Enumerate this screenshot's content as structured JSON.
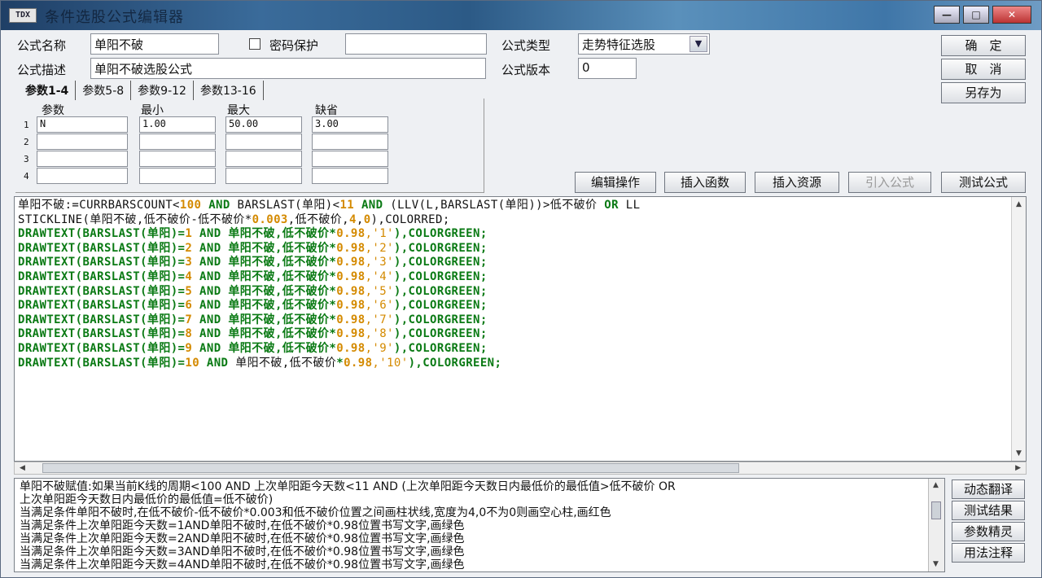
{
  "window": {
    "icon_text": "TDX",
    "title": "条件选股公式编辑器"
  },
  "form": {
    "name_label": "公式名称",
    "name_value": "单阳不破",
    "password_label": "密码保护",
    "password_value": "",
    "desc_label": "公式描述",
    "desc_value": "单阳不破选股公式",
    "type_label": "公式类型",
    "type_value": "走势特征选股",
    "version_label": "公式版本",
    "version_value": "0"
  },
  "buttons": {
    "ok": "确　定",
    "cancel": "取　消",
    "save_as": "另存为",
    "edit_op": "编辑操作",
    "insert_func": "插入函数",
    "insert_resource": "插入资源",
    "import_formula": "引入公式",
    "test_formula": "测试公式",
    "dynamic_translate": "动态翻译",
    "test_result": "测试结果",
    "param_wizard": "参数精灵",
    "usage_notes": "用法注释"
  },
  "tabs": [
    "参数1-4",
    "参数5-8",
    "参数9-12",
    "参数13-16"
  ],
  "params": {
    "headers": [
      "参数",
      "最小",
      "最大",
      "缺省"
    ],
    "rows": [
      {
        "num": "1",
        "name": "N",
        "min": "1.00",
        "max": "50.00",
        "default": "3.00"
      },
      {
        "num": "2",
        "name": "",
        "min": "",
        "max": "",
        "default": ""
      },
      {
        "num": "3",
        "name": "",
        "min": "",
        "max": "",
        "default": ""
      },
      {
        "num": "4",
        "name": "",
        "min": "",
        "max": "",
        "default": ""
      }
    ]
  },
  "code_lines": [
    [
      {
        "t": "单阳不破:=CURRBARSCOUNT<",
        "c": "black"
      },
      {
        "t": "100",
        "c": "num"
      },
      {
        "t": " AND ",
        "c": "kw"
      },
      {
        "t": "BARSLAST(单阳)<",
        "c": "black"
      },
      {
        "t": "11",
        "c": "num"
      },
      {
        "t": " AND ",
        "c": "kw"
      },
      {
        "t": "(LLV(L,BARSLAST(单阳))>低不破价 ",
        "c": "black"
      },
      {
        "t": "OR",
        "c": "kw"
      },
      {
        "t": " LL",
        "c": "black"
      }
    ],
    [
      {
        "t": "STICKLINE(单阳不破,低不破价-低不破价*",
        "c": "black"
      },
      {
        "t": "0.003",
        "c": "num"
      },
      {
        "t": ",低不破价,",
        "c": "black"
      },
      {
        "t": "4",
        "c": "num"
      },
      {
        "t": ",",
        "c": "black"
      },
      {
        "t": "0",
        "c": "num"
      },
      {
        "t": "),COLORRED;",
        "c": "black"
      }
    ],
    [
      {
        "t": "DRAWTEXT(BARSLAST(单阳)=",
        "c": "kw"
      },
      {
        "t": "1",
        "c": "num"
      },
      {
        "t": " AND 单阳不破,低不破价*",
        "c": "kw"
      },
      {
        "t": "0.98",
        "c": "num"
      },
      {
        "t": ",'1'",
        "c": "str"
      },
      {
        "t": "),COLORGREEN;",
        "c": "kw"
      }
    ],
    [
      {
        "t": "DRAWTEXT(BARSLAST(单阳)=",
        "c": "kw"
      },
      {
        "t": "2",
        "c": "num"
      },
      {
        "t": " AND 单阳不破,低不破价*",
        "c": "kw"
      },
      {
        "t": "0.98",
        "c": "num"
      },
      {
        "t": ",'2'",
        "c": "str"
      },
      {
        "t": "),COLORGREEN;",
        "c": "kw"
      }
    ],
    [
      {
        "t": "DRAWTEXT(BARSLAST(单阳)=",
        "c": "kw"
      },
      {
        "t": "3",
        "c": "num"
      },
      {
        "t": " AND 单阳不破,低不破价*",
        "c": "kw"
      },
      {
        "t": "0.98",
        "c": "num"
      },
      {
        "t": ",'3'",
        "c": "str"
      },
      {
        "t": "),COLORGREEN;",
        "c": "kw"
      }
    ],
    [
      {
        "t": "DRAWTEXT(BARSLAST(单阳)=",
        "c": "kw"
      },
      {
        "t": "4",
        "c": "num"
      },
      {
        "t": " AND 单阳不破,低不破价*",
        "c": "kw"
      },
      {
        "t": "0.98",
        "c": "num"
      },
      {
        "t": ",'4'",
        "c": "str"
      },
      {
        "t": "),COLORGREEN;",
        "c": "kw"
      }
    ],
    [
      {
        "t": "DRAWTEXT(BARSLAST(单阳)=",
        "c": "kw"
      },
      {
        "t": "5",
        "c": "num"
      },
      {
        "t": " AND 单阳不破,低不破价*",
        "c": "kw"
      },
      {
        "t": "0.98",
        "c": "num"
      },
      {
        "t": ",'5'",
        "c": "str"
      },
      {
        "t": "),COLORGREEN;",
        "c": "kw"
      }
    ],
    [
      {
        "t": "DRAWTEXT(BARSLAST(单阳)=",
        "c": "kw"
      },
      {
        "t": "6",
        "c": "num"
      },
      {
        "t": " AND 单阳不破,低不破价*",
        "c": "kw"
      },
      {
        "t": "0.98",
        "c": "num"
      },
      {
        "t": ",'6'",
        "c": "str"
      },
      {
        "t": "),COLORGREEN;",
        "c": "kw"
      }
    ],
    [
      {
        "t": "DRAWTEXT(BARSLAST(单阳)=",
        "c": "kw"
      },
      {
        "t": "7",
        "c": "num"
      },
      {
        "t": " AND 单阳不破,低不破价*",
        "c": "kw"
      },
      {
        "t": "0.98",
        "c": "num"
      },
      {
        "t": ",'7'",
        "c": "str"
      },
      {
        "t": "),COLORGREEN;",
        "c": "kw"
      }
    ],
    [
      {
        "t": "DRAWTEXT(BARSLAST(单阳)=",
        "c": "kw"
      },
      {
        "t": "8",
        "c": "num"
      },
      {
        "t": " AND 单阳不破,低不破价*",
        "c": "kw"
      },
      {
        "t": "0.98",
        "c": "num"
      },
      {
        "t": ",'8'",
        "c": "str"
      },
      {
        "t": "),COLORGREEN;",
        "c": "kw"
      }
    ],
    [
      {
        "t": "DRAWTEXT(BARSLAST(单阳)=",
        "c": "kw"
      },
      {
        "t": "9",
        "c": "num"
      },
      {
        "t": " AND 单阳不破,低不破价*",
        "c": "kw"
      },
      {
        "t": "0.98",
        "c": "num"
      },
      {
        "t": ",'9'",
        "c": "str"
      },
      {
        "t": "),COLORGREEN;",
        "c": "kw"
      }
    ],
    [
      {
        "t": "DRAWTEXT(BARSLAST(单阳)=",
        "c": "kw"
      },
      {
        "t": "10",
        "c": "num"
      },
      {
        "t": " AND ",
        "c": "kw"
      },
      {
        "t": "单阳不破,低不破价",
        "c": "black"
      },
      {
        "t": "*",
        "c": "kw"
      },
      {
        "t": "0.98",
        "c": "num"
      },
      {
        "t": ",'10'",
        "c": "str"
      },
      {
        "t": "),COLORGREEN;",
        "c": "kw"
      }
    ]
  ],
  "description_lines": [
    "单阳不破赋值:如果当前K线的周期<100 AND 上次单阳距今天数<11 AND (上次单阳距今天数日内最低价的最低值>低不破价 OR",
    "上次单阳距今天数日内最低价的最低值=低不破价)",
    "当满足条件单阳不破时,在低不破价-低不破价*0.003和低不破价位置之间画柱状线,宽度为4,0不为0则画空心柱,画红色",
    "当满足条件上次单阳距今天数=1AND单阳不破时,在低不破价*0.98位置书写文字,画绿色",
    "当满足条件上次单阳距今天数=2AND单阳不破时,在低不破价*0.98位置书写文字,画绿色",
    "当满足条件上次单阳距今天数=3AND单阳不破时,在低不破价*0.98位置书写文字,画绿色",
    "当满足条件上次单阳距今天数=4AND单阳不破时,在低不破价*0.98位置书写文字,画绿色"
  ]
}
